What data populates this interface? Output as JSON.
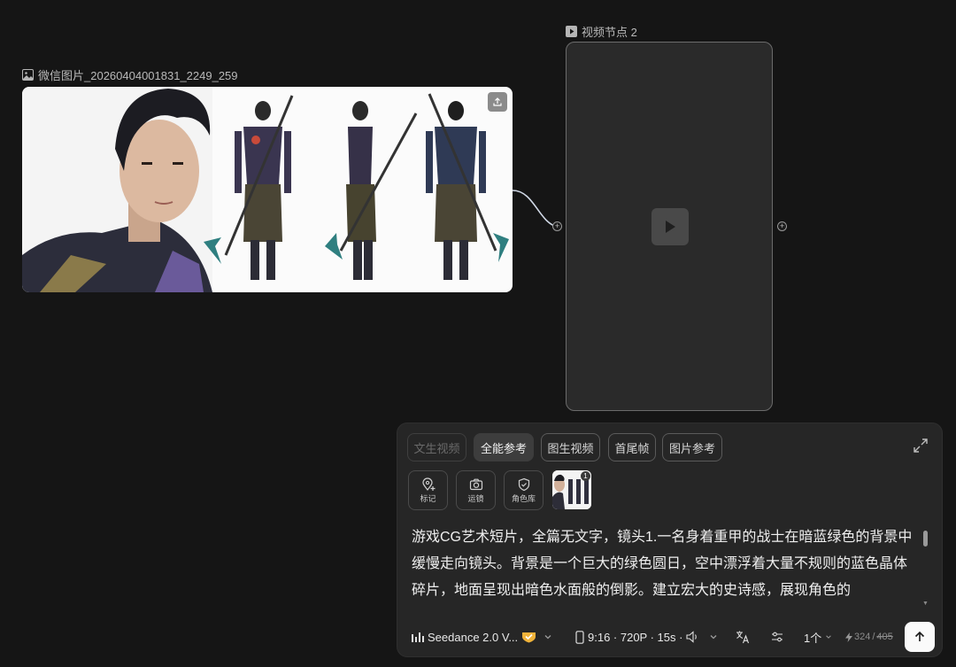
{
  "image_node": {
    "label": "微信图片_20260404001831_2249_259",
    "icon": "image-icon",
    "upload_icon": "upload-icon"
  },
  "video_node": {
    "label": "视频节点 2",
    "icon": "play-square-icon",
    "center_icon": "play-icon"
  },
  "prompt_panel": {
    "tabs": [
      {
        "label": "文生视频",
        "state": "disabled"
      },
      {
        "label": "全能参考",
        "state": "active"
      },
      {
        "label": "图生视频",
        "state": "normal"
      },
      {
        "label": "首尾帧",
        "state": "normal"
      },
      {
        "label": "图片参考",
        "state": "normal"
      }
    ],
    "expand_icon": "expand-icon",
    "tools": [
      {
        "label": "标记",
        "icon": "map-pin-plus-icon"
      },
      {
        "label": "运镜",
        "icon": "camera-icon"
      },
      {
        "label": "角色库",
        "icon": "shield-check-icon"
      }
    ],
    "reference_count": "1",
    "prompt": "游戏CG艺术短片，全篇无文字，镜头1.一名身着重甲的战士在暗蓝绿色的背景中缓慢走向镜头。背景是一个巨大的绿色圆日，空中漂浮着大量不规则的蓝色晶体碎片，地面呈现出暗色水面般的倒影。建立宏大的史诗感，展现角色的",
    "model": "Seedance 2.0 V...",
    "format": "9:16 · 720P · 15s ·",
    "count": "1个",
    "credits_used": "324",
    "credits_sep": "/",
    "credits_total": "405",
    "accent_color": "#f0b33a"
  }
}
